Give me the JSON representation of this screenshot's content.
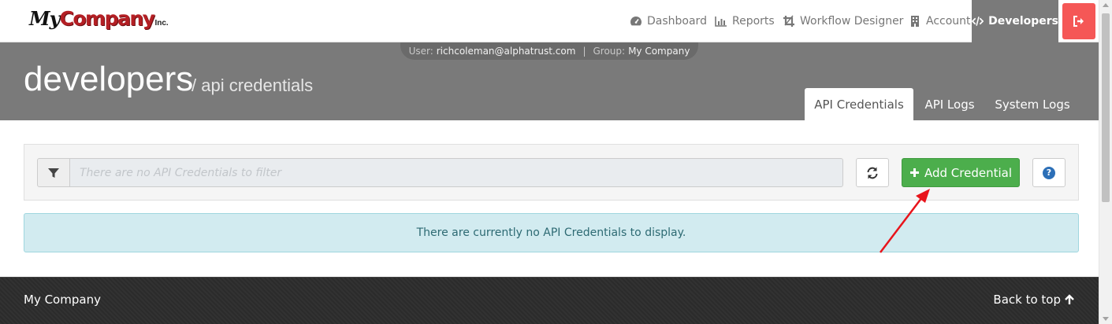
{
  "brand": {
    "my": "My",
    "company": "Company",
    "inc": "Inc."
  },
  "nav": {
    "dashboard": "Dashboard",
    "reports": "Reports",
    "workflow": "Workflow Designer",
    "account": "Account",
    "developers": "Developers"
  },
  "session": {
    "user_label": "User:",
    "user_value": "richcoleman@alphatrust.com",
    "separator": "|",
    "group_label": "Group:",
    "group_value": "My Company"
  },
  "page": {
    "title": "developers",
    "subtitle": "/ api credentials"
  },
  "tabs": [
    {
      "label": "API Credentials",
      "active": true
    },
    {
      "label": "API Logs",
      "active": false
    },
    {
      "label": "System Logs",
      "active": false
    }
  ],
  "toolbar": {
    "filter_placeholder": "There are no API Credentials to filter",
    "add_label": "Add Credential",
    "help_glyph": "?"
  },
  "alert": {
    "message": "There are currently no API Credentials to display."
  },
  "footer": {
    "company": "My Company",
    "back_to_top": "Back to top"
  },
  "colors": {
    "brand_red": "#b41f24",
    "header_gray": "#7a7a7a",
    "logout_red": "#f55756",
    "success_green": "#4cae4c",
    "info_bg": "#d2ebf0",
    "footer_bg": "#2b2b2b",
    "annotation_red": "#e8141b"
  },
  "icons": {
    "dashboard": "tachometer-icon",
    "reports": "bar-chart-icon",
    "workflow": "crop-tool-icon",
    "account": "building-icon",
    "developers": "code-icon",
    "logout": "sign-out-icon",
    "filter": "filter-icon",
    "refresh": "refresh-icon",
    "add": "plus-icon",
    "help": "question-circle-icon",
    "back_to_top": "arrow-up-icon"
  }
}
